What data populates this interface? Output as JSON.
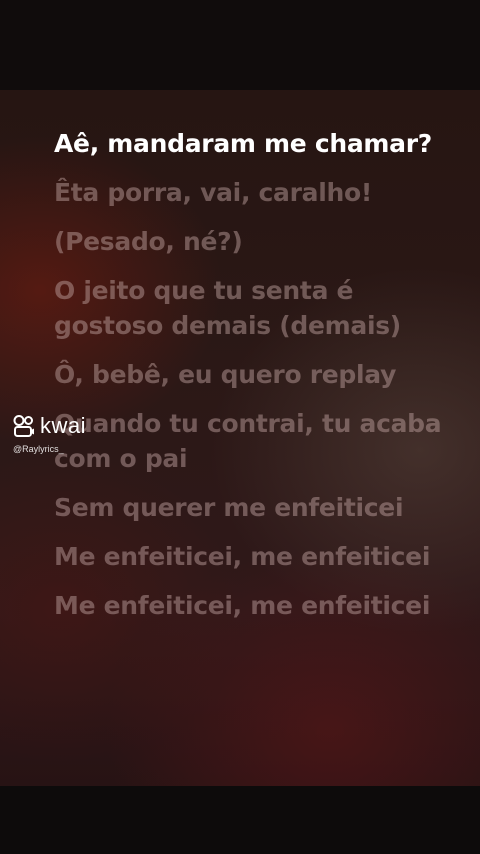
{
  "lyrics": [
    {
      "text": "Aê, mandaram me chamar?",
      "active": true
    },
    {
      "text": "Êta porra, vai, caralho!",
      "active": false
    },
    {
      "text": "(Pesado, né?)",
      "active": false
    },
    {
      "text": "O jeito que tu senta é gostoso demais (demais)",
      "active": false
    },
    {
      "text": "Ô, bebê, eu quero replay",
      "active": false
    },
    {
      "text": "Quando tu contrai, tu acaba com o pai",
      "active": false
    },
    {
      "text": "Sem querer me enfeiticei",
      "active": false
    },
    {
      "text": "Me enfeiticei, me enfeiticei",
      "active": false
    },
    {
      "text": "Me enfeiticei, me enfeiticei",
      "active": false
    }
  ],
  "watermark": {
    "brand": "kwai",
    "handle": "@Raylyrics_",
    "icon": "kwai-logo-icon"
  },
  "colors": {
    "active_lyric": "#ffffff",
    "inactive_lyric": "#bea09e"
  }
}
